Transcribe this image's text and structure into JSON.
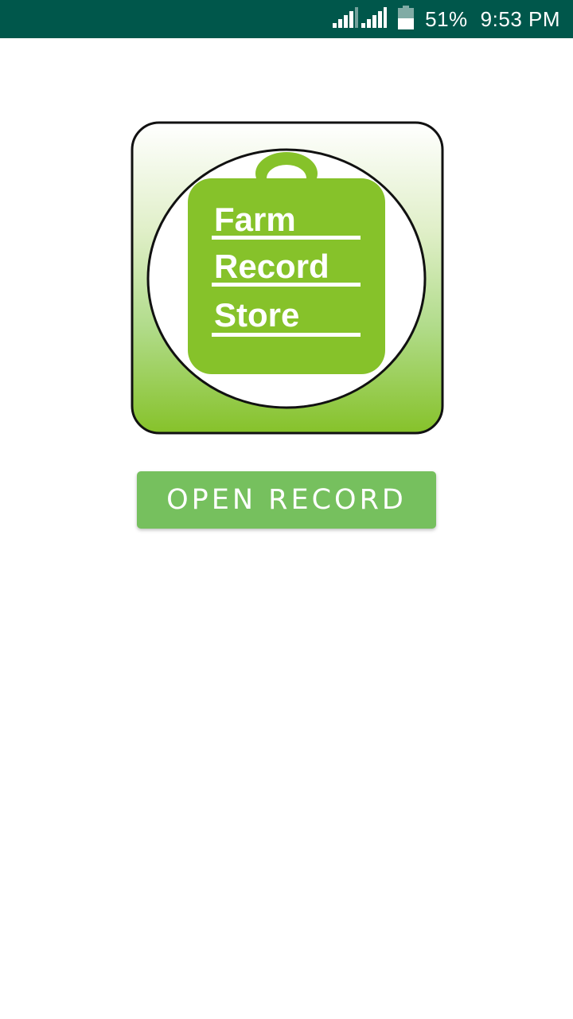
{
  "status_bar": {
    "battery": "51%",
    "time": "9:53 PM",
    "icons": [
      "signal-sim1-icon",
      "signal-sim2-icon",
      "battery-icon"
    ]
  },
  "logo": {
    "line1": "Farm",
    "line2": "Record",
    "line3": "Store"
  },
  "actions": {
    "open_record_label": "OPEN RECORD"
  },
  "colors": {
    "status_bar": "#00574b",
    "brand_green": "#86c22a",
    "button": "#76c05e"
  }
}
